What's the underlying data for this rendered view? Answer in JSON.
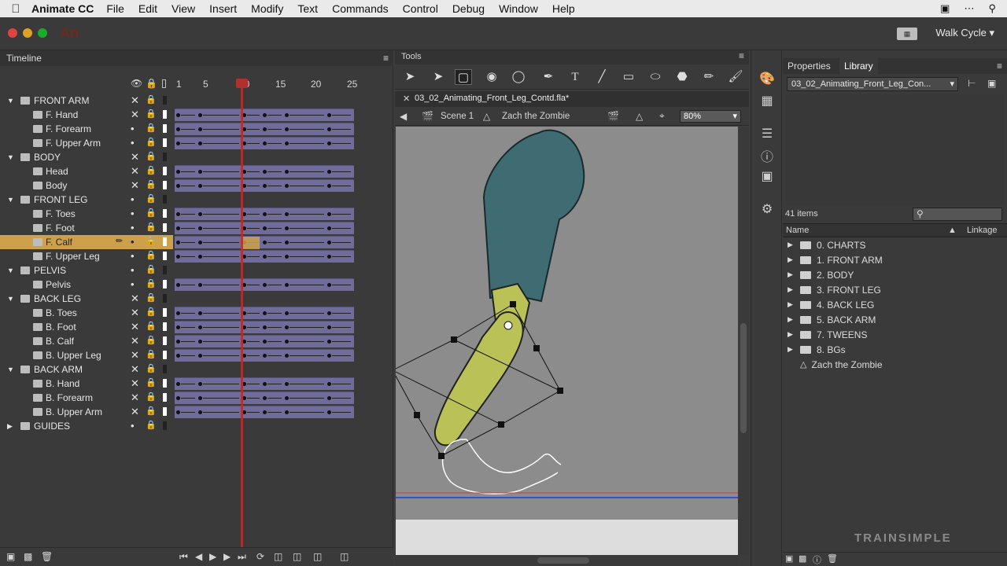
{
  "menubar": {
    "app": "Animate CC",
    "items": [
      "File",
      "Edit",
      "View",
      "Insert",
      "Modify",
      "Text",
      "Commands",
      "Control",
      "Debug",
      "Window",
      "Help"
    ]
  },
  "titlebar": {
    "logo": "An",
    "workspace": "Walk Cycle"
  },
  "timeline": {
    "title": "Timeline",
    "frame_numbers": [
      "1",
      "5",
      "10",
      "15",
      "20",
      "25"
    ],
    "layers": [
      {
        "name": "FRONT ARM",
        "folder": true
      },
      {
        "name": "F. Hand"
      },
      {
        "name": "F. Forearm"
      },
      {
        "name": "F. Upper Arm"
      },
      {
        "name": "BODY",
        "folder": true
      },
      {
        "name": "Head"
      },
      {
        "name": "Body"
      },
      {
        "name": "FRONT LEG",
        "folder": true
      },
      {
        "name": "F. Toes"
      },
      {
        "name": "F. Foot"
      },
      {
        "name": "F. Calf",
        "selected": true
      },
      {
        "name": "F. Upper Leg"
      },
      {
        "name": "PELVIS",
        "folder": true
      },
      {
        "name": "Pelvis"
      },
      {
        "name": "BACK LEG",
        "folder": true
      },
      {
        "name": "B. Toes"
      },
      {
        "name": "B. Foot"
      },
      {
        "name": "B. Calf"
      },
      {
        "name": "B. Upper Leg"
      },
      {
        "name": "BACK ARM",
        "folder": true
      },
      {
        "name": "B. Hand"
      },
      {
        "name": "B. Forearm"
      },
      {
        "name": "B. Upper Arm"
      },
      {
        "name": "GUIDES",
        "folder": true
      }
    ]
  },
  "tools": {
    "title": "Tools",
    "icons": [
      "selection-tool-icon",
      "subselection-tool-icon",
      "free-transform-tool-icon",
      "3d-rotation-tool-icon",
      "lasso-tool-icon",
      "pen-tool-icon",
      "text-tool-icon",
      "line-tool-icon",
      "rectangle-tool-icon",
      "oval-tool-icon",
      "polystar-tool-icon",
      "pencil-tool-icon",
      "brush-tool-icon"
    ]
  },
  "document": {
    "tab": "03_02_Animating_Front_Leg_Contd.fla*",
    "scene": "Scene 1",
    "symbol": "Zach the Zombie",
    "zoom": "80%"
  },
  "library": {
    "tab_properties": "Properties",
    "tab_library": "Library",
    "dropdown": "03_02_Animating_Front_Leg_Con...",
    "count": "41 items",
    "col_name": "Name",
    "col_linkage": "Linkage",
    "items": [
      {
        "label": "0. CHARTS",
        "folder": true
      },
      {
        "label": "1. FRONT ARM",
        "folder": true
      },
      {
        "label": "2. BODY",
        "folder": true
      },
      {
        "label": "3. FRONT LEG",
        "folder": true
      },
      {
        "label": "4. BACK LEG",
        "folder": true
      },
      {
        "label": "5. BACK ARM",
        "folder": true
      },
      {
        "label": "7. TWEENS",
        "folder": true
      },
      {
        "label": "8. BGs",
        "folder": true
      },
      {
        "label": "Zach the Zombie",
        "folder": false
      }
    ]
  },
  "watermark": "TRAINSIMPLE",
  "colors": {
    "frames": "#6f6b9a",
    "selected_layer": "#cda14b",
    "playhead": "#b03030",
    "zombie_hair": "#3e6c72",
    "zombie_leg": "#b9c157"
  }
}
